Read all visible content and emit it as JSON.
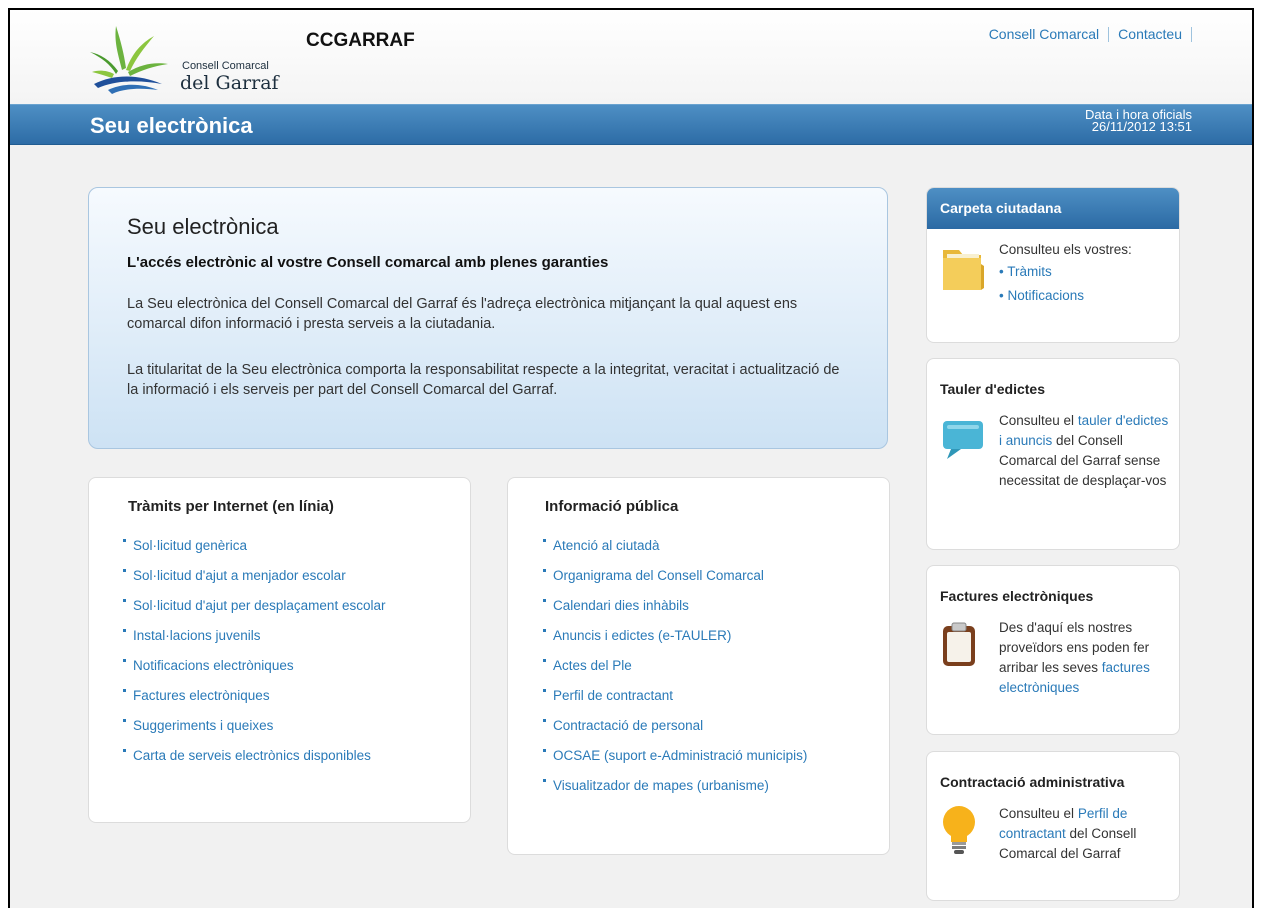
{
  "header": {
    "logo_line1": "Consell Comarcal",
    "logo_line2": "del Garraf",
    "site_name": "CCGARRAF",
    "links": [
      "Consell Comarcal",
      "Contacteu"
    ]
  },
  "bar": {
    "title": "Seu electrònica",
    "time_label": "Data i hora oficials",
    "time_value": "26/11/2012 13:51"
  },
  "intro": {
    "title": "Seu electrònica",
    "subtitle": "L'accés electrònic al vostre Consell comarcal amb plenes garanties",
    "p1": "La Seu electrònica del Consell Comarcal del Garraf és l'adreça electrònica mitjançant la qual aquest ens comarcal difon informació i presta serveis a la ciutadania.",
    "p2": "La titularitat de la Seu electrònica comporta la responsabilitat respecte a la integritat, veracitat i actualització de la informació i els serveis per part del Consell Comarcal del Garraf."
  },
  "tramits": {
    "title": "Tràmits per Internet (en línia)",
    "items": [
      "Sol·licitud genèrica",
      "Sol·licitud d'ajut a menjador escolar",
      "Sol·licitud d'ajut per desplaçament escolar",
      "Instal·lacions juvenils",
      "Notificacions electròniques",
      "Factures electròniques",
      "Suggeriments i queixes",
      "Carta de serveis electrònics disponibles"
    ]
  },
  "info": {
    "title": "Informació pública",
    "items": [
      "Atenció al ciutadà",
      "Organigrama del Consell Comarcal",
      "Calendari dies inhàbils",
      "Anuncis i edictes (e-TAULER)",
      "Actes del Ple",
      "Perfil de contractant",
      "Contractació de personal",
      "OCSAE (suport e-Administració municipis)",
      "Visualitzador de mapes (urbanisme)"
    ]
  },
  "carpeta": {
    "title": "Carpeta ciutadana",
    "intro": "Consulteu els vostres:",
    "items": [
      "Tràmits",
      "Notificacions"
    ]
  },
  "tauler": {
    "title": "Tauler d'edictes",
    "t1": "Consulteu el ",
    "link": "tauler d'edictes i anuncis",
    "t2": " del Consell Comarcal del Garraf sense necessitat de desplaçar-vos"
  },
  "factures": {
    "title": "Factures electròniques",
    "t1": "Des d'aquí els nostres proveïdors ens poden fer arribar les seves ",
    "link": "factures electròniques"
  },
  "contractacio": {
    "title": "Contractació administrativa",
    "t1": "Consulteu el ",
    "link": "Perfil de contractant",
    "t2": " del Consell Comarcal del Garraf"
  },
  "colors": {
    "accent": "#2d6ca6",
    "link": "#2a7ab8"
  }
}
